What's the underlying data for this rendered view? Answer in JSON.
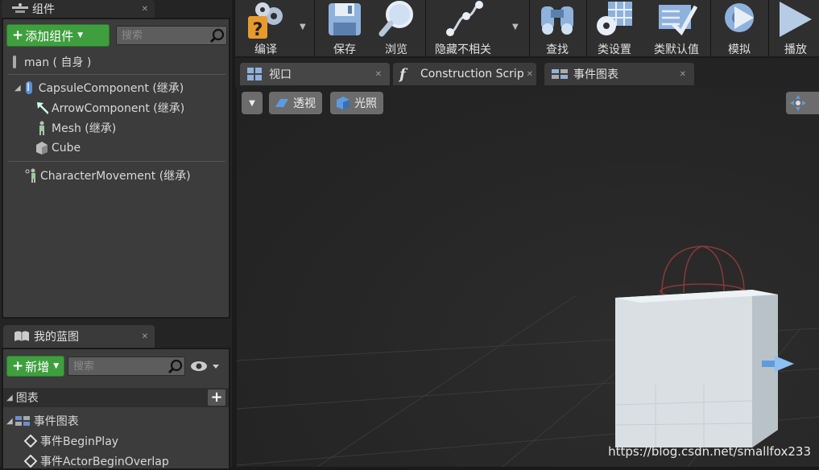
{
  "components_panel": {
    "tab_title": "组件",
    "add_button": "添加组件",
    "search_placeholder": "搜索",
    "root": "man ( 自身 )",
    "items": [
      {
        "label": "CapsuleComponent (继承)"
      },
      {
        "label": "ArrowComponent (继承)"
      },
      {
        "label": "Mesh (继承)"
      },
      {
        "label": "Cube"
      },
      {
        "label": "CharacterMovement (继承)"
      }
    ]
  },
  "my_blueprint_panel": {
    "tab_title": "我的蓝图",
    "new_button": "新增",
    "search_placeholder": "搜索",
    "section_title": "图表",
    "graph_name": "事件图表",
    "events": [
      "事件BeginPlay",
      "事件ActorBeginOverlap"
    ]
  },
  "toolbar": {
    "buttons": [
      {
        "label": "编译",
        "icon": "compile-icon"
      },
      {
        "label": "保存",
        "icon": "save-icon"
      },
      {
        "label": "浏览",
        "icon": "browse-icon"
      },
      {
        "label": "隐藏不相关",
        "icon": "hide-unrelated-icon"
      },
      {
        "label": "查找",
        "icon": "find-icon"
      },
      {
        "label": "类设置",
        "icon": "class-settings-icon"
      },
      {
        "label": "类默认值",
        "icon": "class-defaults-icon"
      },
      {
        "label": "模拟",
        "icon": "simulate-icon"
      },
      {
        "label": "播放",
        "icon": "play-icon"
      }
    ]
  },
  "doc_tabs": [
    {
      "label": "视口",
      "icon": "viewport-icon"
    },
    {
      "label": "Construction Scrip",
      "icon": "function-icon"
    },
    {
      "label": "事件图表",
      "icon": "event-graph-icon"
    }
  ],
  "viewport": {
    "perspective_label": "透视",
    "lighting_label": "光照",
    "watermark": "https://blog.csdn.net/smallfox233"
  },
  "colors": {
    "accent_green": "#3f9f3f",
    "panel_bg": "#3c3c3c",
    "toolbar_bg": "#2f2f2f",
    "viewport_bg": "#262626"
  }
}
